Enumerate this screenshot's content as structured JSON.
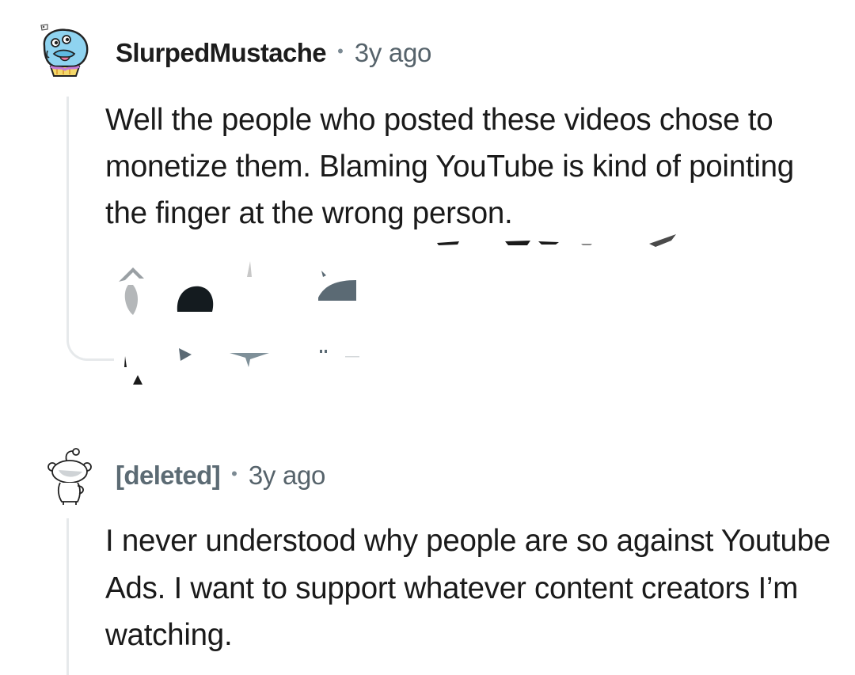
{
  "comments": [
    {
      "author": "SlurpedMustache",
      "separator": "•",
      "age": "3y ago",
      "avatar_icon": "blue-blob-avatar-icon",
      "body": "Well the people who posted these videos chose to monetize them. Blaming YouTube is kind of pointing the finger at the wrong person."
    },
    {
      "author": "[deleted]",
      "separator": "•",
      "age": "3y ago",
      "avatar_icon": "snoo-avatar-icon",
      "body": "I never understood why people are so against Youtube Ads. I want to support whatever content creators I’m watching."
    }
  ],
  "colors": {
    "author": "#1c1c1c",
    "deleted_author": "#5c6b74",
    "meta": "#56636b",
    "thread_line": "#e6e9eb",
    "body_text": "#1a1a1a"
  }
}
